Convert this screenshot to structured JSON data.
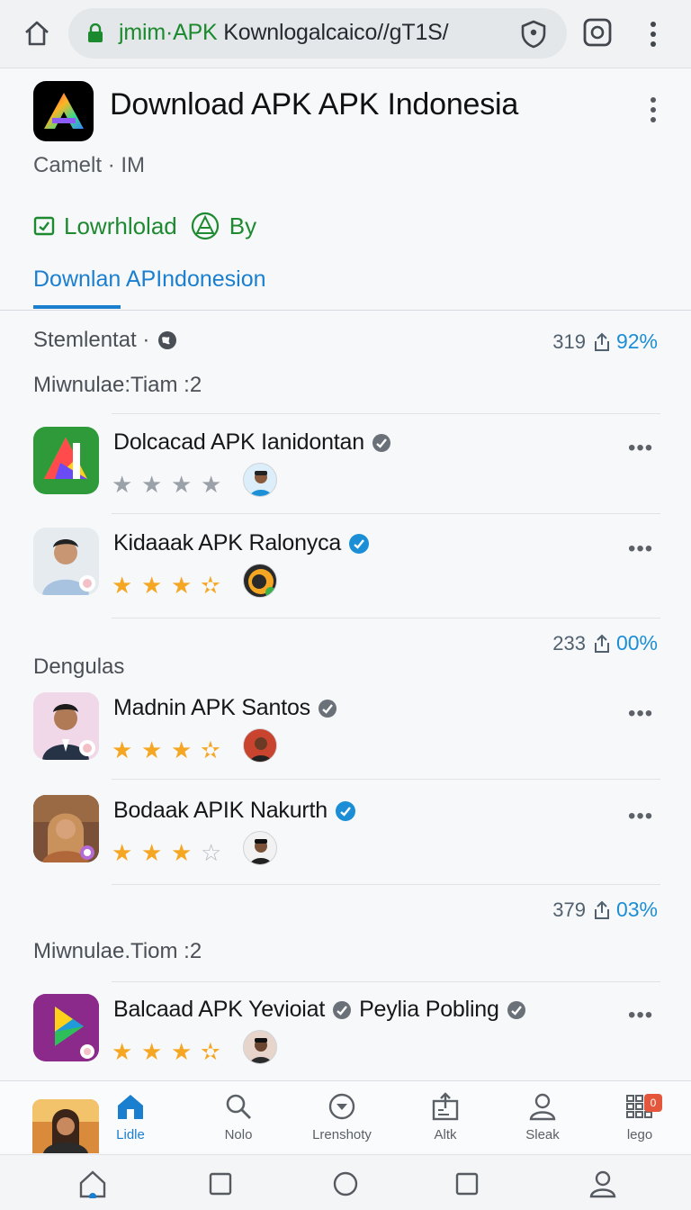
{
  "browser": {
    "url_host": "jmim·APK",
    "url_path": " Kownlogalcaico//gT1S/"
  },
  "app": {
    "title": "Download APK APK Indonesia",
    "subtitle": "Camelt · IM",
    "actions": {
      "download_label": "Lowrhlolad",
      "by_label": "By"
    },
    "active_tab": "Downlan APIndonesion"
  },
  "sections": [
    {
      "title": "Stemlentat ·",
      "stat_count": "319",
      "stat_pct": "92%"
    },
    {
      "title": "Miwnulae:Tiam :2"
    },
    {
      "title": "Dengulas",
      "stat_count": "233",
      "stat_pct": "00%"
    },
    {
      "title": "Miwnulae.Tiom :2",
      "stat_count": "379",
      "stat_pct": "03%"
    }
  ],
  "items": [
    {
      "name": "Dolcacad APK Ianidontan",
      "rating": 0,
      "max": 4,
      "verified_color": "#6b7178"
    },
    {
      "name": "Kidaaak APK Ralonyca",
      "rating": 3.5,
      "max": 4,
      "verified_color": "#1b8ed6"
    },
    {
      "name": "Madnin APK Santos",
      "rating": 3.5,
      "max": 4,
      "verified_color": "#6b7178"
    },
    {
      "name": "Bodaak APIK Nakurth",
      "rating": 3,
      "max": 4,
      "verified_color": "#1b8ed6"
    },
    {
      "name": "Balcaad APK Yevioiat",
      "name_extra": "Peylia Pobling",
      "rating": 3.5,
      "max": 4,
      "verified_color": "#6b7178"
    }
  ],
  "more_label": "•••",
  "bottom_nav": [
    {
      "label": "Lidle",
      "icon": "home-icon",
      "active": true
    },
    {
      "label": "Nolo",
      "icon": "search-icon"
    },
    {
      "label": "Lrenshoty",
      "icon": "download-icon"
    },
    {
      "label": "Altk",
      "icon": "upload-icon"
    },
    {
      "label": "Sleak",
      "icon": "person-icon"
    },
    {
      "label": "lego",
      "icon": "grid-icon",
      "badge": "0"
    }
  ],
  "colors": {
    "accent": "#1b7fcf",
    "green": "#1d8a30",
    "star": "#f5a623"
  }
}
